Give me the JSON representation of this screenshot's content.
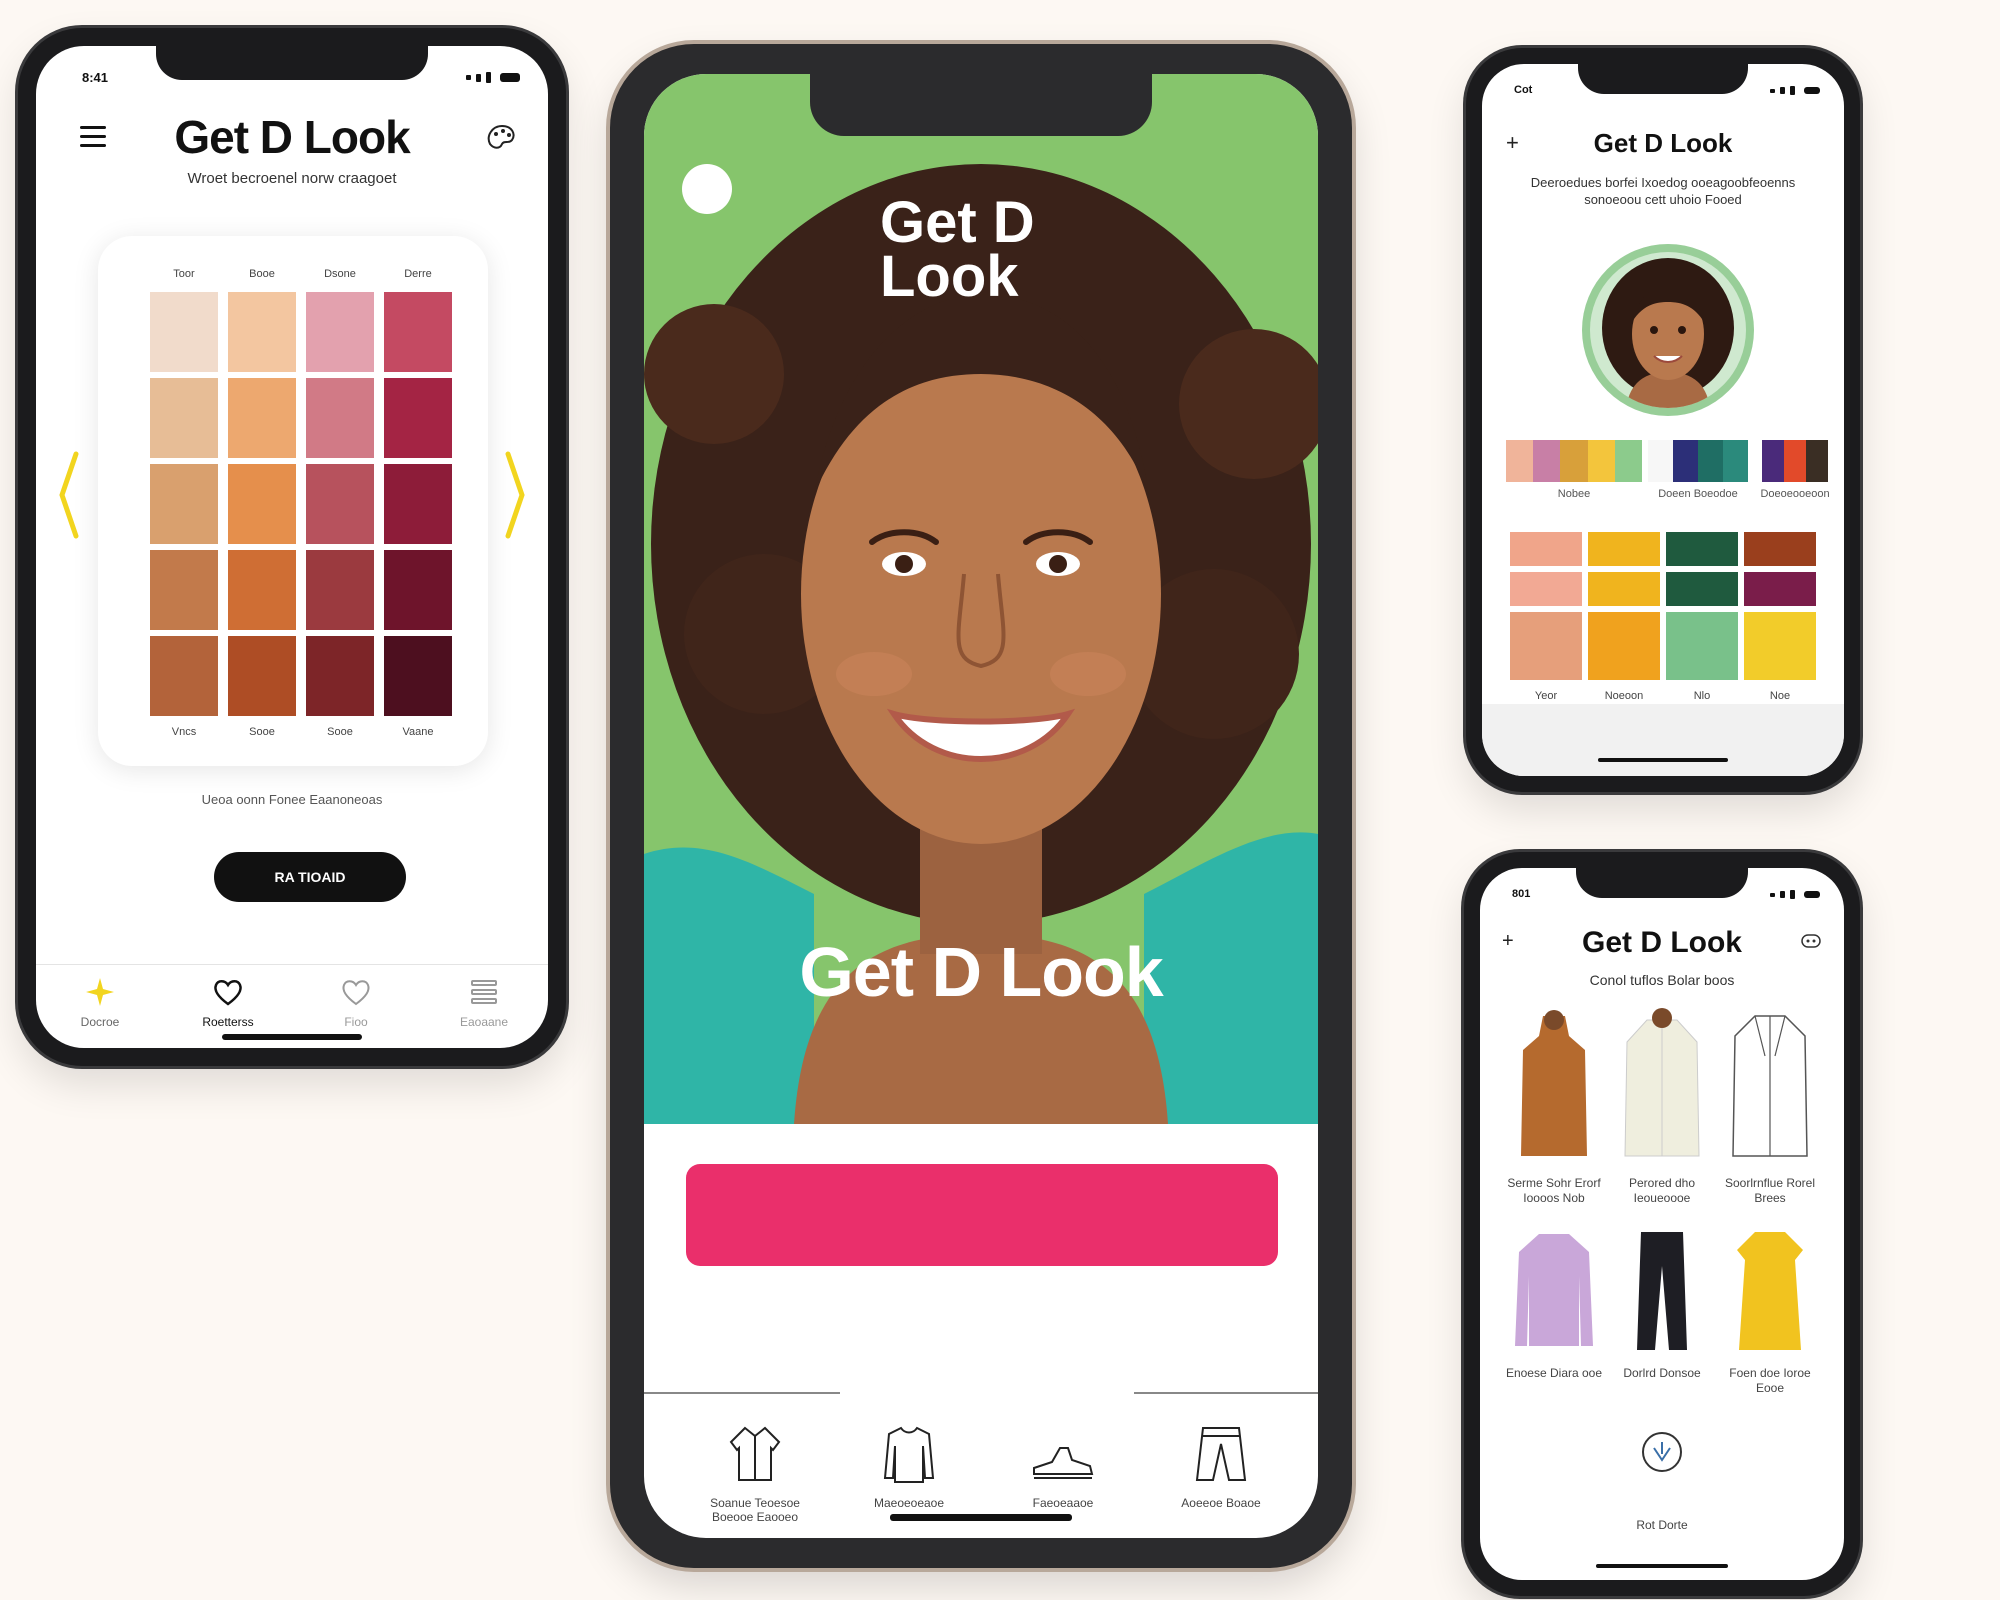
{
  "app_name": "Get D Look",
  "phone1": {
    "time": "8:41",
    "title": "Get D Look",
    "subtitle": "Wroet becroenel norw craagoet",
    "column_headers": [
      "Toor",
      "Booe",
      "Dsone",
      "Derre"
    ],
    "row_footers": [
      "Vncs",
      "Sooe",
      "Sooe",
      "Vaane"
    ],
    "swatches": [
      [
        "#f1dbcb",
        "#f3c6a0",
        "#e3a1ae",
        "#c44a62"
      ],
      [
        "#e7bd96",
        "#eda86f",
        "#d17a86",
        "#a42444"
      ],
      [
        "#d9a06e",
        "#e58f4c",
        "#b7525d",
        "#8d1c39"
      ],
      [
        "#c27a4b",
        "#cf6e34",
        "#9b3a3f",
        "#6e142b"
      ],
      [
        "#b3633a",
        "#ae4d25",
        "#7d2528",
        "#4d0f1f"
      ]
    ],
    "caption": "Ueoa oonn Fonee Eaanoneoas",
    "button_label": "RA TIOAID",
    "tabs": [
      {
        "label": "Docroe",
        "icon": "sparkle-icon",
        "active": true
      },
      {
        "label": "Roetterss",
        "icon": "heart-icon",
        "active": false
      },
      {
        "label": "Fioo",
        "icon": "heart-outline-icon",
        "active": false
      },
      {
        "label": "Eaoaane",
        "icon": "list-icon",
        "active": false
      }
    ]
  },
  "phone2": {
    "hero_title_line1": "Get D",
    "hero_title_line2": "Look",
    "hero_tagline": "Get D Look",
    "cta_label": "",
    "categories": [
      {
        "label": "Soanue Teoesoe Boeooe Eaooeo",
        "icon": "jacket-icon"
      },
      {
        "label": "Maeoeoeaoe",
        "icon": "sweater-icon"
      },
      {
        "label": "Faeoeaaoe",
        "icon": "shoe-icon"
      },
      {
        "label": "Aoeeoe Boaoe",
        "icon": "pants-icon"
      }
    ]
  },
  "phone3": {
    "time": "Cot",
    "title": "Get D Look",
    "description": "Deeroedues borfei Ixoedog ooeagoobfeoenns sonoeoou cett uhoio Fooed",
    "palettes": [
      {
        "label": "Nobee",
        "colors": [
          "#f0b49a",
          "#c87fa6",
          "#d8a03a",
          "#f3c53c",
          "#8ccb8c"
        ]
      },
      {
        "label": "Doeen Boeodoe",
        "colors": [
          "#f7f7f7",
          "#2c2f78",
          "#1f6e64",
          "#2b8a7c"
        ]
      },
      {
        "label": "Doeoeooeoon",
        "colors": [
          "#4a2a7a",
          "#e24a2a",
          "#3a2e24"
        ]
      }
    ],
    "grid": [
      [
        "#f0a58a",
        "#f0b41e",
        "#1f5a3e",
        "#9a3f1d"
      ],
      [
        "#f2a994",
        "#f0b41e",
        "#1f5a3e",
        "#7a1d4a"
      ],
      [
        "#e69f7b",
        "#f0a21e",
        "#79c18a",
        "#f2cc2a"
      ]
    ],
    "grid_labels": [
      "Yeor",
      "Noeoon",
      "Nlo",
      "Noe"
    ]
  },
  "phone4": {
    "time": "801",
    "title": "Get D Look",
    "subtitle": "Conol tuflos Bolar boos",
    "items": [
      {
        "caption": "Serme Sohr Erorf Ioooos Nob",
        "color": "#b56a2e",
        "icon": "sweater-item-icon"
      },
      {
        "caption": "Perored dho Ieoueoooe",
        "color": "#efeede",
        "icon": "blazer-item-icon"
      },
      {
        "caption": "Soorlrnflue Rorel Brees",
        "color": "#ffffff",
        "icon": "coat-item-icon"
      },
      {
        "caption": "Enoese Diara ooe",
        "color": "#c9a7d9",
        "icon": "blouse-item-icon"
      },
      {
        "caption": "Dorlrd Donsoe",
        "color": "#1e1e24",
        "icon": "trousers-item-icon"
      },
      {
        "caption": "Foen doe Ioroe Eooe",
        "color": "#f1c31f",
        "icon": "dress-item-icon"
      }
    ],
    "footer_label": "Rot Dorte"
  }
}
